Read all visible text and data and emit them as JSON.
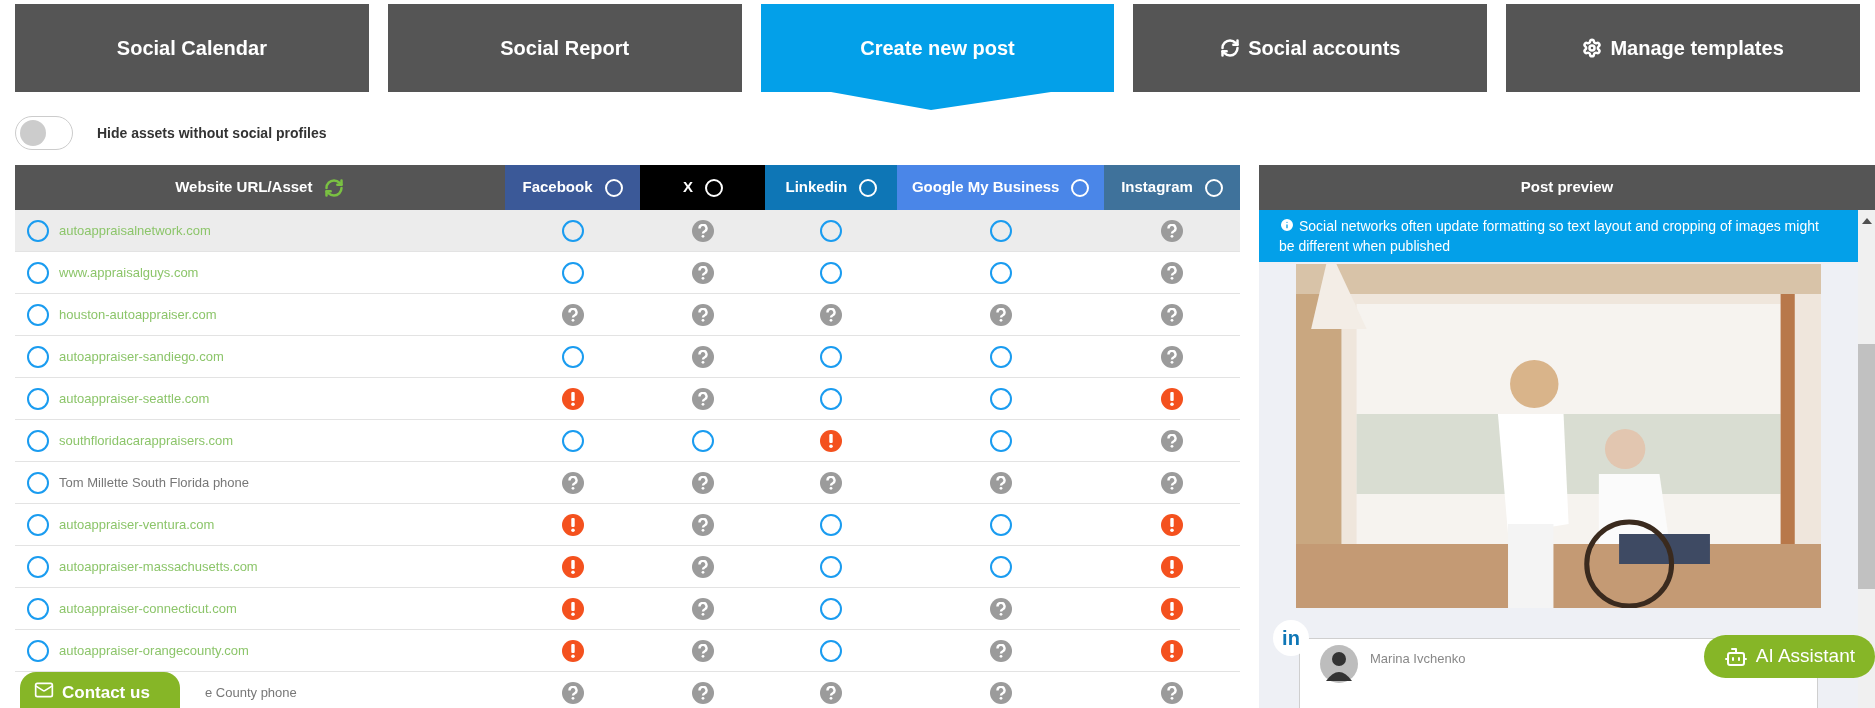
{
  "tabs": [
    {
      "label": "Social Calendar",
      "kind": "plain",
      "selected": false
    },
    {
      "label": "Social Report",
      "kind": "plain",
      "selected": false
    },
    {
      "label": "Create new post",
      "kind": "plain",
      "selected": true
    },
    {
      "label": "Social accounts",
      "kind": "sync",
      "selected": false
    },
    {
      "label": "Manage templates",
      "kind": "settings",
      "selected": false
    }
  ],
  "filter_toggle": {
    "label": "Hide assets without social profiles",
    "on": false
  },
  "table": {
    "asset_header": "Website URL/Asset",
    "columns": [
      {
        "name": "Facebook",
        "color": "#3b5998"
      },
      {
        "name": "X",
        "color": "#000000"
      },
      {
        "name": "Linkedin",
        "color": "#0e76b6"
      },
      {
        "name": "Google My Business",
        "color": "#4a86e8"
      },
      {
        "name": "Instagram",
        "color": "#3f729b"
      }
    ],
    "rows": [
      {
        "asset": "autoappraisalnetwork.com",
        "kind": "url",
        "selected": true,
        "cells": [
          {
            "kind": "empty"
          },
          {
            "kind": "unknown"
          },
          {
            "kind": "empty"
          },
          {
            "kind": "empty"
          },
          {
            "kind": "unknown"
          }
        ]
      },
      {
        "asset": "www.appraisalguys.com",
        "kind": "url",
        "selected": false,
        "cells": [
          {
            "kind": "empty"
          },
          {
            "kind": "unknown"
          },
          {
            "kind": "empty"
          },
          {
            "kind": "empty"
          },
          {
            "kind": "unknown"
          }
        ]
      },
      {
        "asset": "houston-autoappraiser.com",
        "kind": "url",
        "selected": false,
        "cells": [
          {
            "kind": "unknown"
          },
          {
            "kind": "unknown"
          },
          {
            "kind": "unknown"
          },
          {
            "kind": "unknown"
          },
          {
            "kind": "unknown"
          }
        ]
      },
      {
        "asset": "autoappraiser-sandiego.com",
        "kind": "url",
        "selected": false,
        "cells": [
          {
            "kind": "empty"
          },
          {
            "kind": "unknown"
          },
          {
            "kind": "empty"
          },
          {
            "kind": "empty"
          },
          {
            "kind": "unknown"
          }
        ]
      },
      {
        "asset": "autoappraiser-seattle.com",
        "kind": "url",
        "selected": false,
        "cells": [
          {
            "kind": "error"
          },
          {
            "kind": "unknown"
          },
          {
            "kind": "empty"
          },
          {
            "kind": "empty"
          },
          {
            "kind": "error"
          }
        ]
      },
      {
        "asset": "southfloridacarappraisers.com",
        "kind": "url",
        "selected": false,
        "cells": [
          {
            "kind": "empty"
          },
          {
            "kind": "empty"
          },
          {
            "kind": "error"
          },
          {
            "kind": "empty"
          },
          {
            "kind": "unknown"
          }
        ]
      },
      {
        "asset": "Tom Millette South Florida phone",
        "kind": "label",
        "selected": false,
        "cells": [
          {
            "kind": "unknown"
          },
          {
            "kind": "unknown"
          },
          {
            "kind": "unknown"
          },
          {
            "kind": "unknown"
          },
          {
            "kind": "unknown"
          }
        ]
      },
      {
        "asset": "autoappraiser-ventura.com",
        "kind": "url",
        "selected": false,
        "cells": [
          {
            "kind": "error"
          },
          {
            "kind": "unknown"
          },
          {
            "kind": "empty"
          },
          {
            "kind": "empty"
          },
          {
            "kind": "error"
          }
        ]
      },
      {
        "asset": "autoappraiser-massachusetts.com",
        "kind": "url",
        "selected": false,
        "cells": [
          {
            "kind": "error"
          },
          {
            "kind": "unknown"
          },
          {
            "kind": "empty"
          },
          {
            "kind": "empty"
          },
          {
            "kind": "error"
          }
        ]
      },
      {
        "asset": "autoappraiser-connecticut.com",
        "kind": "url",
        "selected": false,
        "cells": [
          {
            "kind": "error"
          },
          {
            "kind": "unknown"
          },
          {
            "kind": "empty"
          },
          {
            "kind": "unknown"
          },
          {
            "kind": "error"
          }
        ]
      },
      {
        "asset": "autoappraiser-orangecounty.com",
        "kind": "url",
        "selected": false,
        "cells": [
          {
            "kind": "error"
          },
          {
            "kind": "unknown"
          },
          {
            "kind": "empty"
          },
          {
            "kind": "unknown"
          },
          {
            "kind": "error"
          }
        ]
      },
      {
        "asset": "e County phone",
        "kind": "label",
        "selected": false,
        "cells": [
          {
            "kind": "unknown"
          },
          {
            "kind": "unknown"
          },
          {
            "kind": "unknown"
          },
          {
            "kind": "unknown"
          },
          {
            "kind": "unknown"
          }
        ]
      }
    ]
  },
  "preview": {
    "title": "Post preview",
    "notice": "Social networks often update formatting so text layout and cropping of images might be different when published",
    "network_badge": "in",
    "author": "Marina Ivchenko"
  },
  "contact_button": "Contact us",
  "ai_button": "AI Assistant"
}
